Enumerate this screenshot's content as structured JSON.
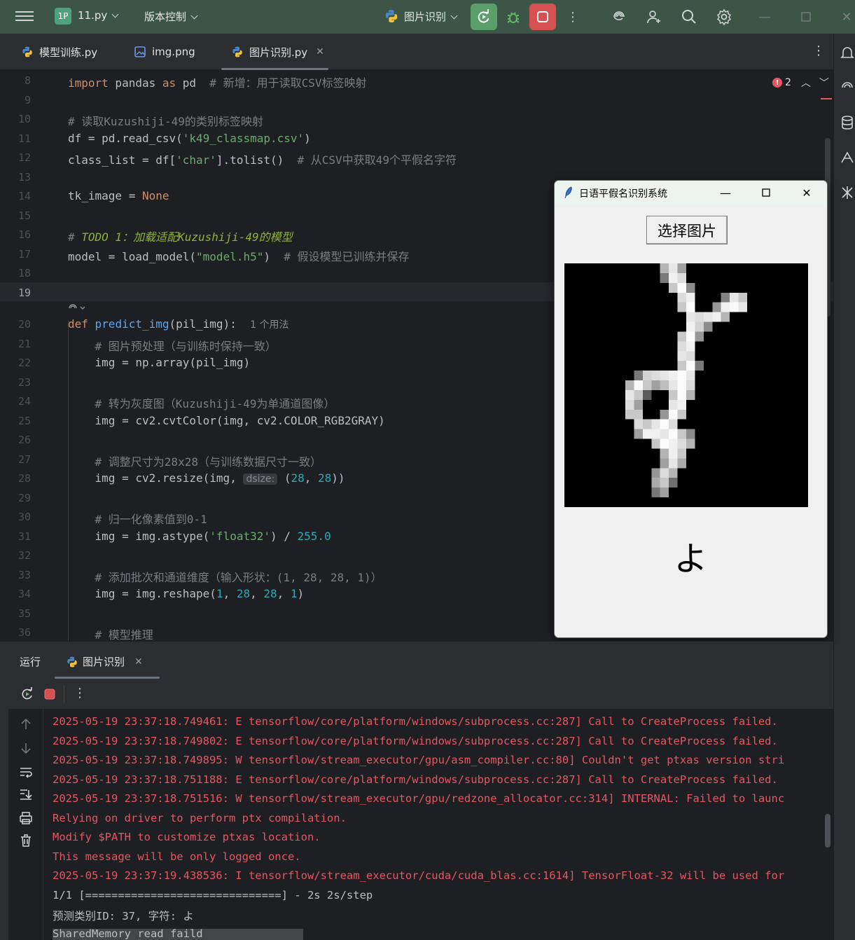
{
  "titlebar": {
    "project_badge": "1P",
    "project_name": "11.py",
    "vcs_label": "版本控制",
    "run_config": "图片识别"
  },
  "tabs": [
    {
      "label": "模型训练.py",
      "type": "python"
    },
    {
      "label": "img.png",
      "type": "image"
    },
    {
      "label": "图片识别.py",
      "type": "python",
      "active": true
    }
  ],
  "editor": {
    "error_count": "2",
    "lines": [
      {
        "n": "8"
      },
      {
        "n": "9"
      },
      {
        "n": "10"
      },
      {
        "n": "11"
      },
      {
        "n": "12"
      },
      {
        "n": "13"
      },
      {
        "n": "14"
      },
      {
        "n": "15"
      },
      {
        "n": "16"
      },
      {
        "n": "17"
      },
      {
        "n": "18"
      },
      {
        "n": "19"
      },
      {
        "n": "20"
      },
      {
        "n": "21"
      },
      {
        "n": "22"
      },
      {
        "n": "23"
      },
      {
        "n": "24"
      },
      {
        "n": "25"
      },
      {
        "n": "26"
      },
      {
        "n": "27"
      },
      {
        "n": "28"
      },
      {
        "n": "29"
      },
      {
        "n": "30"
      },
      {
        "n": "31"
      },
      {
        "n": "32"
      },
      {
        "n": "33"
      },
      {
        "n": "34"
      },
      {
        "n": "35"
      },
      {
        "n": "36"
      }
    ],
    "code": {
      "l8_import": "import",
      "l8_mod": " pandas ",
      "l8_as": "as",
      "l8_alias": " pd  ",
      "l8_cmt": "# 新增：用于读取CSV标签映射",
      "l10_cmt": "# 读取Kuzushiji-49的类别标签映射",
      "l11_a": "df = pd.read_csv(",
      "l11_str": "'k49_classmap.csv'",
      "l11_b": ")",
      "l12_a": "class_list = df[",
      "l12_str": "'char'",
      "l12_b": "].tolist()  ",
      "l12_cmt": "# 从CSV中获取49个平假名字符",
      "l14_a": "tk_image = ",
      "l14_none": "None",
      "l16_cmt": "# ",
      "l16_todo": "TODO 1：加载适配Kuzushiji-49的模型",
      "l17_a": "model = load_model(",
      "l17_str": "\"model.h5\"",
      "l17_b": ")  ",
      "l17_cmt": "# 假设模型已训练并保存",
      "l20_def": "def",
      "l20_fn": " predict_img",
      "l20_b": "(pil_img):",
      "l20_usage": "1 个用法",
      "l21_cmt": "# 图片预处理（与训练时保持一致）",
      "l22": "img = np.array(pil_img)",
      "l24_cmt": "# 转为灰度图（Kuzushiji-49为单通道图像）",
      "l25": "img = cv2.cvtColor(img, cv2.COLOR_RGB2GRAY)",
      "l27_cmt": "# 调整尺寸为28x28（与训练数据尺寸一致）",
      "l28_a": "img = cv2.resize(img, ",
      "l28_hint": "dsize:",
      "l28_b": " (",
      "l28_n1": "28",
      "l28_c": ", ",
      "l28_n2": "28",
      "l28_d": "))",
      "l30_cmt": "# 归一化像素值到0-1",
      "l31_a": "img = img.astype(",
      "l31_str": "'float32'",
      "l31_b": ") / ",
      "l31_num": "255.0",
      "l33_cmt": "# 添加批次和通道维度（输入形状：(1, 28, 28, 1)）",
      "l34_a": "img = img.reshape(",
      "l34_n1": "1",
      "l34_c1": ", ",
      "l34_n2": "28",
      "l34_c2": ", ",
      "l34_n3": "28",
      "l34_c3": ", ",
      "l34_n4": "1",
      "l34_d": ")",
      "l36_cmt": "# 模型推理"
    }
  },
  "tk_window": {
    "title": "日语平假名识别系统",
    "button_label": "选择图片",
    "result_char": "よ"
  },
  "run_panel": {
    "tab_run": "运行",
    "tab_config": "图片识别",
    "console_lines": [
      {
        "text": "2025-05-19 23:37:18.749461: E tensorflow/core/platform/windows/subprocess.cc:287] Call to CreateProcess failed.",
        "kind": "err"
      },
      {
        "text": "2025-05-19 23:37:18.749802: E tensorflow/core/platform/windows/subprocess.cc:287] Call to CreateProcess failed.",
        "kind": "err"
      },
      {
        "text": "2025-05-19 23:37:18.749895: W tensorflow/stream_executor/gpu/asm_compiler.cc:80] Couldn't get ptxas version stri",
        "kind": "err"
      },
      {
        "text": "2025-05-19 23:37:18.751188: E tensorflow/core/platform/windows/subprocess.cc:287] Call to CreateProcess failed.",
        "kind": "err"
      },
      {
        "text": "2025-05-19 23:37:18.751516: W tensorflow/stream_executor/gpu/redzone_allocator.cc:314] INTERNAL: Failed to launc",
        "kind": "err"
      },
      {
        "text": "Relying on driver to perform ptx compilation.",
        "kind": "err"
      },
      {
        "text": "Modify $PATH to customize ptxas location.",
        "kind": "err"
      },
      {
        "text": "This message will be only logged once.",
        "kind": "err"
      },
      {
        "text": "2025-05-19 23:37:19.438536: I tensorflow/stream_executor/cuda/cuda_blas.cc:1614] TensorFloat-32 will be used for",
        "kind": "err"
      },
      {
        "text": "1/1 [==============================] - 2s 2s/step",
        "kind": "norm"
      },
      {
        "text": "预测类别ID: 37, 字符: よ",
        "kind": "norm"
      },
      {
        "text": "SharedMemory read faild",
        "kind": "norm"
      }
    ]
  }
}
